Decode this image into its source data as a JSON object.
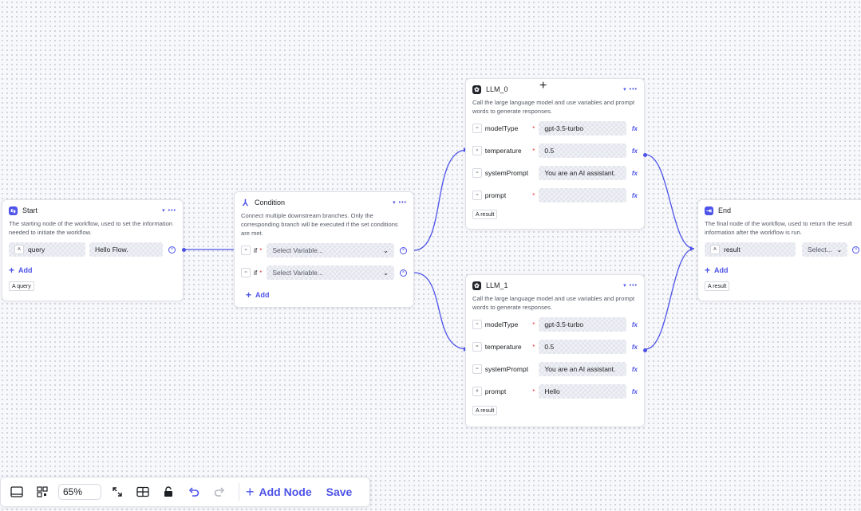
{
  "nodes": {
    "start": {
      "title": "Start",
      "description": "The starting node of the workflow, used to set the information needed to initiate the workflow.",
      "field_type": "A",
      "field_name": "query",
      "field_value": "Hello Flow.",
      "add_label": "Add",
      "output_tag": "A query"
    },
    "condition": {
      "title": "Condition",
      "description": "Connect multiple downstream branches. Only the corresponding branch will be executed if the set conditions are met.",
      "branches": [
        {
          "keyword": "if",
          "placeholder": "Select Variable..."
        },
        {
          "keyword": "if",
          "placeholder": "Select Variable..."
        }
      ],
      "add_label": "Add"
    },
    "llm0": {
      "title": "LLM_0",
      "description": "Call the large language model and use variables and prompt words to generate responses.",
      "fields": [
        {
          "name": "modelType",
          "value": "gpt-3.5-turbo"
        },
        {
          "name": "temperature",
          "value": "0.5"
        },
        {
          "name": "systemPrompt",
          "value": "You are an AI assistant."
        },
        {
          "name": "prompt",
          "value": ""
        }
      ],
      "output_tag": "A result"
    },
    "llm1": {
      "title": "LLM_1",
      "description": "Call the large language model and use variables and prompt words to generate responses.",
      "fields": [
        {
          "name": "modelType",
          "value": "gpt-3.5-turbo"
        },
        {
          "name": "temperature",
          "value": "0.5"
        },
        {
          "name": "systemPrompt",
          "value": "You are an AI assistant."
        },
        {
          "name": "prompt",
          "value": "Hello"
        }
      ],
      "output_tag": "A result"
    },
    "end": {
      "title": "End",
      "description": "The final node of the workflow, used to return the result information after the workflow is run.",
      "field_name": "result",
      "select_placeholder": "Select...",
      "add_label": "Add",
      "output_tag": "A result"
    }
  },
  "toolbar": {
    "zoom": "65%",
    "add_node_label": "Add Node",
    "save_label": "Save"
  },
  "colors": {
    "accent": "#4d53e8",
    "required": "#e53935"
  }
}
